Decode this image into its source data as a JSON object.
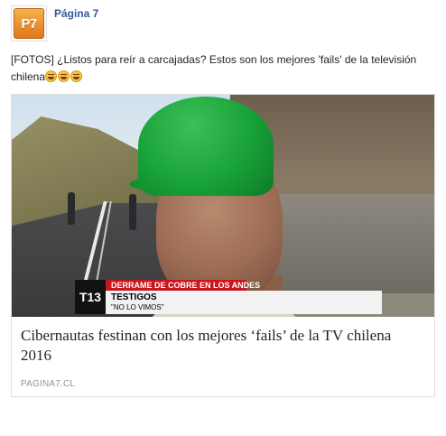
{
  "post": {
    "page_name": "Página 7",
    "avatar_text": "P7",
    "text": "[FOTOS] ¿Listos para reír a carcajadas? Estos son los mejores 'fails' de la televisión chilena",
    "emoji": [
      "joy-emoji",
      "joy-emoji",
      "joy-emoji"
    ]
  },
  "link_card": {
    "title": "Cibernautas festinan con los mejores ‘fails’ de la TV chilena 2016",
    "domain": "PAGINA7.CL",
    "image": {
      "ticker_band": "DERRAME DE COBRE EN LOS ANDES",
      "ticker_headline": "TESTIGOS",
      "ticker_subline": "\"NO LO VIMOS\"",
      "channel_logo": "T13"
    }
  },
  "colors": {
    "link_blue": "#365899",
    "text": "#1d2129",
    "muted": "#90949c",
    "border": "#dddfe2",
    "ticker_red": "#c8161e",
    "helmet_green": "#18a238"
  }
}
